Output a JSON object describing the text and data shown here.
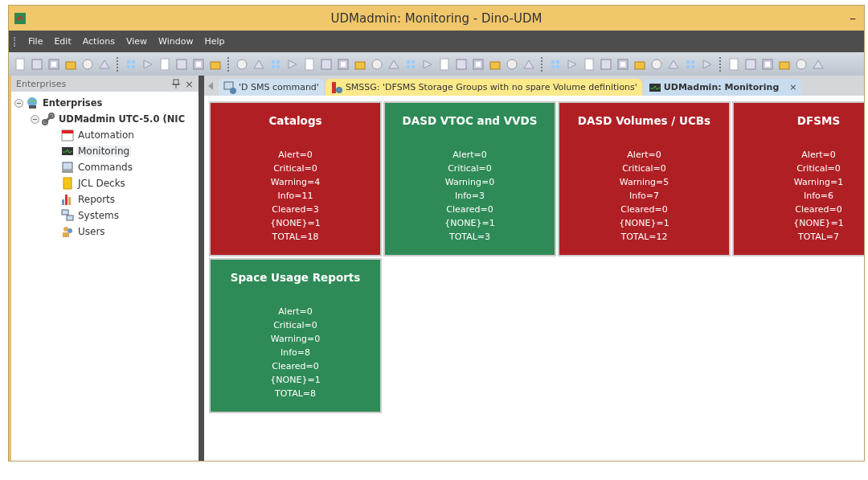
{
  "window": {
    "title": "UDMadmin: Monitoring - Dino-UDM",
    "minimize": "–"
  },
  "menu": [
    "File",
    "Edit",
    "Actions",
    "View",
    "Window",
    "Help"
  ],
  "sidebar": {
    "title": "Enterprises",
    "close": "×",
    "tree": [
      {
        "label": "Enterprises",
        "expanded": true,
        "bold": true,
        "children": [
          {
            "label": "UDMadmin UTC-5.0 (NIC",
            "expanded": true,
            "bold": true,
            "children": [
              {
                "label": "Automation",
                "selected": false
              },
              {
                "label": "Monitoring",
                "selected": true
              },
              {
                "label": "Commands",
                "selected": false
              },
              {
                "label": "JCL Decks",
                "selected": false
              },
              {
                "label": "Reports",
                "selected": false
              },
              {
                "label": "Systems",
                "selected": false
              },
              {
                "label": "Users",
                "selected": false
              }
            ]
          }
        ]
      }
    ]
  },
  "tabs": [
    {
      "label": "'D SMS command'",
      "selected": false,
      "highlighted": false
    },
    {
      "label": "SMSSG: 'DFSMS Storage Groups with no spare Volume definitions'",
      "selected": false,
      "highlighted": true
    },
    {
      "label": "UDMadmin: Monitoring",
      "selected": true,
      "highlighted": false,
      "close": "×"
    }
  ],
  "tiles": [
    {
      "title": "Catalogs",
      "color": "#b01f24",
      "lines": [
        "Alert=0",
        "Critical=0",
        "Warning=4",
        "Info=11",
        "Cleared=3",
        "{NONE}=1",
        "TOTAL=18"
      ]
    },
    {
      "title": "DASD VTOC and VVDS",
      "color": "#2e8b57",
      "lines": [
        "Alert=0",
        "Critical=0",
        "Warning=0",
        "Info=3",
        "Cleared=0",
        "{NONE}=1",
        "TOTAL=3"
      ]
    },
    {
      "title": "DASD Volumes / UCBs",
      "color": "#b01f24",
      "lines": [
        "Alert=0",
        "Critical=0",
        "Warning=5",
        "Info=7",
        "Cleared=0",
        "{NONE}=1",
        "TOTAL=12"
      ]
    },
    {
      "title": "DFSMS",
      "color": "#b01f24",
      "lines": [
        "Alert=0",
        "Critical=0",
        "Warning=1",
        "Info=6",
        "Cleared=0",
        "{NONE}=1",
        "TOTAL=7"
      ]
    },
    {
      "title": "Space Usage Reports",
      "color": "#2e8b57",
      "lines": [
        "Alert=0",
        "Critical=0",
        "Warning=0",
        "Info=8",
        "Cleared=0",
        "{NONE}=1",
        "TOTAL=8"
      ]
    }
  ]
}
